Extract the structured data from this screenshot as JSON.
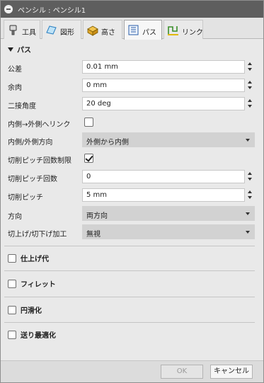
{
  "window": {
    "title": "ペンシル : ペンシル1"
  },
  "tabs": [
    {
      "label": "工具",
      "icon": "tool-icon"
    },
    {
      "label": "図形",
      "icon": "geometry-icon"
    },
    {
      "label": "高さ",
      "icon": "heights-icon"
    },
    {
      "label": "パス",
      "icon": "passes-icon",
      "active": true
    },
    {
      "label": "リンク",
      "icon": "linking-icon"
    }
  ],
  "section": {
    "title": "パス"
  },
  "fields": {
    "tolerance": {
      "label": "公差",
      "value": "0.01 mm"
    },
    "stock": {
      "label": "余肉",
      "value": "0 mm"
    },
    "bitangency": {
      "label": "二接角度",
      "value": "20 deg"
    },
    "inside_out": {
      "label": "内側→外側へリンク",
      "checked": false
    },
    "direction_in_out": {
      "label": "内側/外側方向",
      "value": "外側から内側"
    },
    "limit_stepover": {
      "label": "切削ピッチ回数制限",
      "checked": true
    },
    "stepover_count": {
      "label": "切削ピッチ回数",
      "value": "0"
    },
    "stepover": {
      "label": "切削ピッチ",
      "value": "5 mm"
    },
    "direction": {
      "label": "方向",
      "value": "両方向"
    },
    "up_down_milling": {
      "label": "切上げ/切下げ加工",
      "value": "無視"
    }
  },
  "groups": [
    {
      "label": "仕上げ代"
    },
    {
      "label": "フィレット"
    },
    {
      "label": "円滑化"
    },
    {
      "label": "送り最適化"
    }
  ],
  "footer": {
    "ok": "OK",
    "cancel": "キャンセル"
  }
}
